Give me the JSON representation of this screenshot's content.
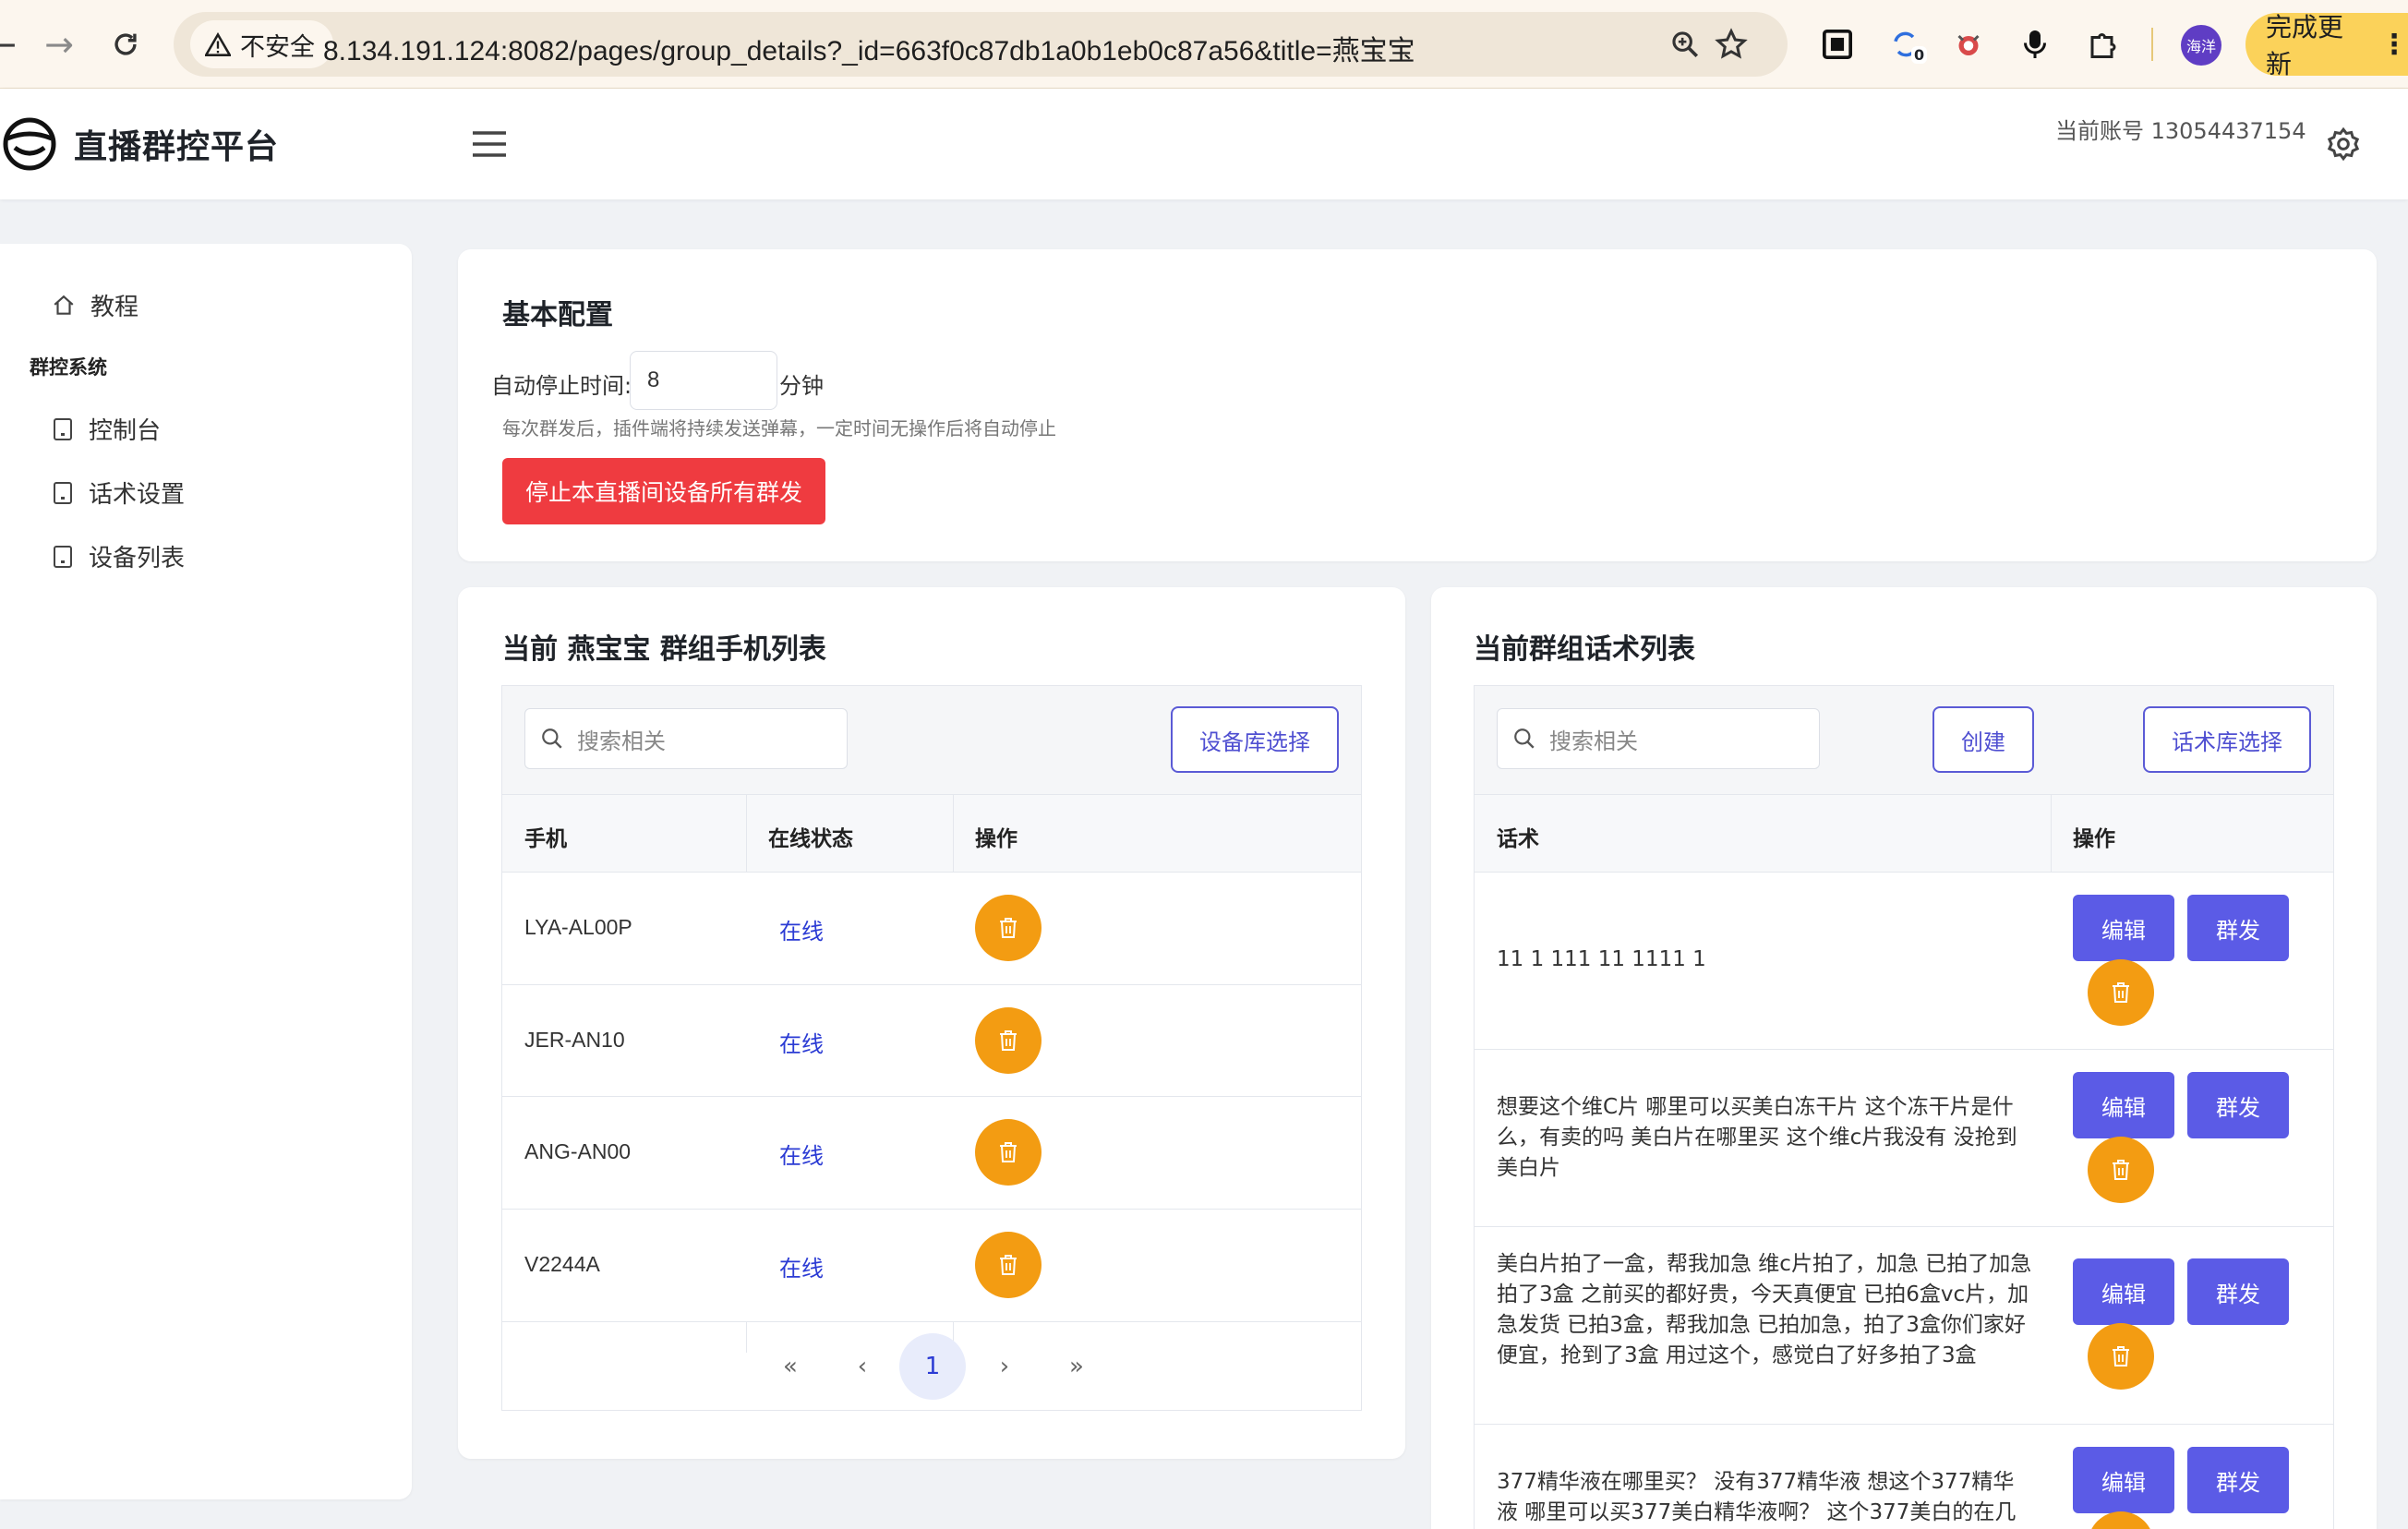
{
  "browser": {
    "security_label": "不安全",
    "url": "8.134.191.124:8082/pages/group_details?_id=663f0c87db1a0b1eb0c87a56&title=燕宝宝",
    "extension_badge": "0",
    "profile_name": "海洋",
    "update_label": "完成更新"
  },
  "header": {
    "brand_title": "直播群控平台",
    "account_label": "当前账号 13054437154"
  },
  "sidebar": {
    "tutorial": "教程",
    "group_heading": "群控系统",
    "items": [
      {
        "label": "控制台"
      },
      {
        "label": "话术设置"
      },
      {
        "label": "设备列表"
      }
    ]
  },
  "config": {
    "title": "基本配置",
    "auto_stop_label": "自动停止时间:",
    "auto_stop_value": "8",
    "auto_stop_unit": "分钟",
    "hint": "每次群发后，插件端将持续发送弹幕，一定时间无操作后将自动停止",
    "stop_button": "停止本直播间设备所有群发"
  },
  "devices": {
    "title": "当前 燕宝宝 群组手机列表",
    "search_placeholder": "搜索相关",
    "library_button": "设备库选择",
    "columns": [
      "手机",
      "在线状态",
      "操作"
    ],
    "rows": [
      {
        "phone": "LYA-AL00P",
        "status": "在线"
      },
      {
        "phone": "JER-AN10",
        "status": "在线"
      },
      {
        "phone": "ANG-AN00",
        "status": "在线"
      },
      {
        "phone": "V2244A",
        "status": "在线"
      }
    ],
    "pagination": {
      "first": "«",
      "prev": "‹",
      "current": "1",
      "next": "›",
      "last": "»"
    }
  },
  "scripts": {
    "title": "当前群组话术列表",
    "search_placeholder": "搜索相关",
    "create_button": "创建",
    "library_button": "话术库选择",
    "columns": [
      "话术",
      "操作"
    ],
    "edit_label": "编辑",
    "send_label": "群发",
    "rows": [
      {
        "text": "11 1 111 11 1111 1"
      },
      {
        "text": "想要这个维C片 哪里可以买美白冻干片 这个冻干片是什么，有卖的吗 美白片在哪里买 这个维c片我没有 没抢到美白片"
      },
      {
        "text": "美白片拍了一盒，帮我加急 维c片拍了，加急 已拍了加急拍了3盒 之前买的都好贵，今天真便宜 已拍6盒vc片，加急发货 已拍3盒，帮我加急 已拍加急，拍了3盒你们家好便宜，抢到了3盒 用过这个，感觉白了好多拍了3盒"
      },
      {
        "text": "377精华液在哪里买？ 没有377精华液 想这个377精华液 哪里可以买377美白精华液啊？ 这个377美白的在几"
      }
    ]
  },
  "colors": {
    "primary": "#5b5be6",
    "danger": "#ef3b40",
    "warning": "#f39c12",
    "online": "#2b3bd4"
  }
}
